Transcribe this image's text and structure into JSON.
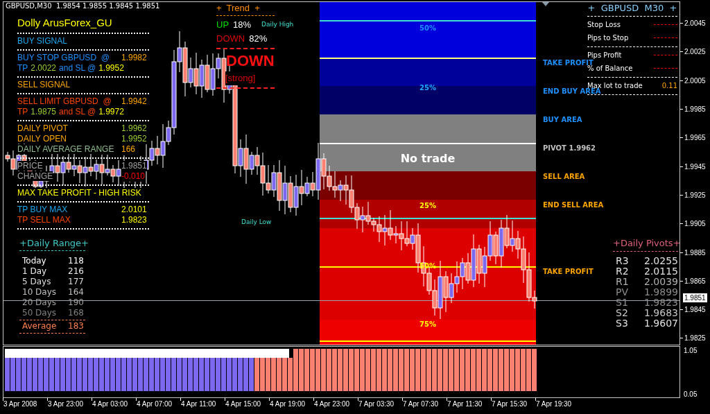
{
  "header": "GBPUSD,M30  1.9854 1.9855 1.9845 1.9851",
  "signal_panel": {
    "title": "Dolly ArusForex_GU",
    "rows": [
      {
        "kind": "rule"
      },
      {
        "kind": "text",
        "parts": [
          {
            "text": "BUY SIGNAL",
            "color": "#1ea8f0"
          }
        ]
      },
      {
        "kind": "rule"
      },
      {
        "kind": "text",
        "parts": [
          {
            "text": "BUY STOP GBPUSD  @",
            "color": "#1e90ff"
          }
        ],
        "value": {
          "text": "1.9982",
          "color": "#ffa500"
        }
      },
      {
        "kind": "text",
        "parts": [
          {
            "text": "TP",
            "color": "#1e90ff"
          },
          {
            "text": "2.0022",
            "color": "#9acd32"
          },
          {
            "text": "and SL @",
            "color": "#1e90ff"
          },
          {
            "text": "1.9952",
            "color": "#ffff00"
          }
        ]
      },
      {
        "kind": "rule"
      },
      {
        "kind": "text",
        "parts": [
          {
            "text": "SELL SIGNAL",
            "color": "#ffa500"
          }
        ]
      },
      {
        "kind": "rule"
      },
      {
        "kind": "text",
        "parts": [
          {
            "text": "SELL LIMIT GBPUSD  @",
            "color": "#ff4500"
          }
        ],
        "value": {
          "text": "1.9942",
          "color": "#ffa500"
        }
      },
      {
        "kind": "text",
        "parts": [
          {
            "text": "TP",
            "color": "#ff4500"
          },
          {
            "text": "1.9875",
            "color": "#9acd32"
          },
          {
            "text": "and SL @",
            "color": "#ff4500"
          },
          {
            "text": "1.9972",
            "color": "#ffff00"
          }
        ]
      },
      {
        "kind": "rule"
      },
      {
        "kind": "text",
        "parts": [
          {
            "text": "DAILY PIVOT",
            "color": "#ffa500"
          }
        ],
        "value": {
          "text": "1.9962",
          "color": "#9acd32"
        }
      },
      {
        "kind": "text",
        "parts": [
          {
            "text": "DAILY OPEN",
            "color": "#ffa500"
          }
        ],
        "value": {
          "text": "1.9952",
          "color": "#9acd32"
        }
      },
      {
        "kind": "text",
        "parts": [
          {
            "text": "DAILY AVERAGE RANGE",
            "color": "#8fbc8f"
          }
        ],
        "value": {
          "text": "166",
          "color": "#ffa500"
        }
      },
      {
        "kind": "rule"
      },
      {
        "kind": "text",
        "parts": [
          {
            "text": "PRICE",
            "color": "#a0a0a0"
          }
        ],
        "value": {
          "text": "1.9851",
          "color": "#a0a0a0"
        }
      },
      {
        "kind": "text",
        "parts": [
          {
            "text": "CHANGE",
            "color": "#a0a0a0"
          }
        ],
        "value": {
          "text": "-0.010",
          "color": "#ff0000"
        }
      },
      {
        "kind": "rule"
      },
      {
        "kind": "text",
        "parts": [
          {
            "text": "MAX TAKE PROFIT - HIGH RISK",
            "color": "#ffff00"
          }
        ]
      },
      {
        "kind": "rule"
      },
      {
        "kind": "text",
        "parts": [
          {
            "text": "TP BUY MAX",
            "color": "#1ea8f0"
          }
        ],
        "value": {
          "text": "2.0101",
          "color": "#ffff00"
        }
      },
      {
        "kind": "text",
        "parts": [
          {
            "text": "TP SELL MAX",
            "color": "#ff4500"
          }
        ],
        "value": {
          "text": "1.9823",
          "color": "#ffff00"
        }
      },
      {
        "kind": "rule"
      }
    ]
  },
  "trend": {
    "title": "+  Trend  +",
    "up": {
      "label": "UP",
      "value": "18%"
    },
    "down": {
      "label": "DOWN",
      "value": "82%"
    },
    "signal": "DOWN",
    "strength": "[strong]"
  },
  "chart_labels": [
    "Daily High",
    "Daily Low"
  ],
  "zones": [
    {
      "color": "#0000dd"
    },
    {
      "color": "#0000dd",
      "line": {
        "color": "#40e0d0"
      },
      "label": {
        "text": "50%",
        "color": "#1e90ff",
        "emphasis": false
      }
    },
    {
      "color": "#00009a",
      "line": {
        "color": "#ffff80"
      },
      "side_label": {
        "text": "TAKE PROFIT",
        "color": "#1e90ff"
      }
    },
    {
      "color": "#000066",
      "label": {
        "text": "25%",
        "color": "#1ea8ff",
        "emphasis": false
      },
      "side_label": {
        "text": "END BUY AREA",
        "color": "#1e90ff"
      }
    },
    {
      "color": "#808080",
      "side_label": {
        "text": "BUY AREA",
        "color": "#1e90ff"
      }
    },
    {
      "color": "#808080",
      "line": {
        "color": "#ffffff"
      },
      "label": {
        "text": "No trade",
        "color": "#ffffff",
        "emphasis": true
      },
      "side_label": {
        "text": "PIVOT 1.9962",
        "color": "#c0c0c0"
      }
    },
    {
      "color": "#7a0000",
      "side_label": {
        "text": "SELL AREA",
        "color": "#ffa500"
      }
    },
    {
      "color": "#b00000",
      "label": {
        "text": "25%",
        "color": "#ffff00",
        "emphasis": false
      },
      "side_label": {
        "text": "END SELL AREA",
        "color": "#ffa500"
      }
    },
    {
      "color": "#b00000",
      "line": {
        "color": "#40e0d0"
      }
    },
    {
      "color": "#dd0000"
    },
    {
      "color": "#dd0000",
      "line": {
        "color": "#ffff00"
      },
      "label": {
        "text": "50%",
        "color": "#ffff00",
        "emphasis": false
      },
      "side_label": {
        "text": "TAKE PROFIT",
        "color": "#ffa500"
      }
    },
    {
      "color": "#ee0000",
      "label": {
        "text": "75%",
        "color": "#ffff00",
        "emphasis": false
      }
    },
    {
      "color": "#ff0000",
      "line": {
        "color": "#ffff00"
      }
    }
  ],
  "account_panel": {
    "title": "+  GBPUSD  M30  +",
    "rows": [
      {
        "kind": "rule"
      },
      {
        "kind": "field",
        "label": "Stop Loss"
      },
      {
        "kind": "field",
        "label": "Pips to Stop"
      },
      {
        "kind": "rule"
      },
      {
        "kind": "field",
        "label": "Pips Profit"
      },
      {
        "kind": "field",
        "label": "% of Balance"
      },
      {
        "kind": "rule"
      },
      {
        "kind": "field",
        "label": "Max lot to trade",
        "value": "0.11"
      },
      {
        "kind": "rule"
      }
    ]
  },
  "daily_range": {
    "title": "+Daily Range+",
    "rows": [
      {
        "label": "Today",
        "value": "118",
        "color": "#ffffff"
      },
      {
        "label": "1 Day",
        "value": "216",
        "color": "#ececec"
      },
      {
        "label": "5 Days",
        "value": "177",
        "color": "#dcdcdc"
      },
      {
        "label": "10 Days",
        "value": "164",
        "color": "#c0c0c0"
      },
      {
        "label": "20 Days",
        "value": "190",
        "color": "#a0a0a0"
      },
      {
        "label": "50 Days",
        "value": "168",
        "color": "#808080"
      }
    ],
    "average": {
      "label": "Average",
      "value": "183"
    }
  },
  "daily_pivots": {
    "title": "+Daily Pivots+",
    "rows": [
      {
        "label": "R3",
        "value": "2.0255",
        "color": "#e0e0e0"
      },
      {
        "label": "R2",
        "value": "2.0115",
        "color": "#e0e0e0"
      },
      {
        "label": "R1",
        "value": "2.0039",
        "color": "#b0b0b0"
      },
      {
        "label": "PV",
        "value": "1.9899",
        "color": "#8c8c8c"
      },
      {
        "label": "S1",
        "value": "1.9823",
        "color": "#8c8c8c"
      },
      {
        "label": "S2",
        "value": "1.9683",
        "color": "#c8c8c8"
      },
      {
        "label": "S3",
        "value": "1.9607",
        "color": "#e0e0e0"
      }
    ]
  },
  "price_axis": {
    "labels": [
      "2.0045",
      "2.0025",
      "2.0005",
      "1.9985",
      "1.9965",
      "1.9945",
      "1.9925",
      "1.9905",
      "1.9885",
      "1.9865",
      "1.9845",
      "1.9825"
    ],
    "current_price": "1.9851"
  },
  "indicator_axis": {
    "labels": [
      "1.05",
      "0.05"
    ]
  },
  "time_axis": {
    "labels": [
      "3 Apr 2008",
      "3 Apr 23:00",
      "4 Apr 03:00",
      "4 Apr 07:00",
      "4 Apr 11:00",
      "4 Apr 15:00",
      "4 Apr 19:00",
      "4 Apr 23:00",
      "7 Apr 03:30",
      "7 Apr 07:30",
      "7 Apr 11:30",
      "7 Apr 15:30",
      "7 Apr 19:30"
    ]
  }
}
